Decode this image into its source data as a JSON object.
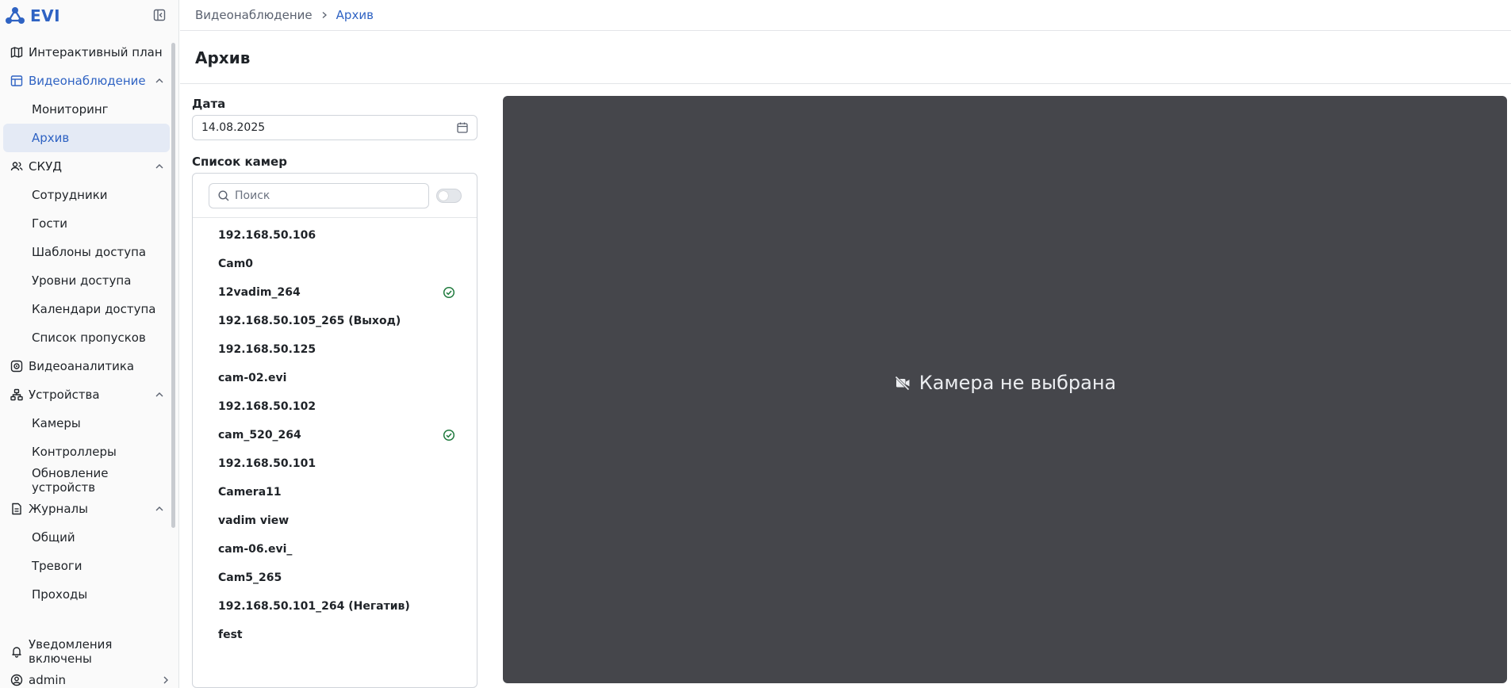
{
  "app": {
    "name": "EVI",
    "brand_color": "#2f63c3"
  },
  "breadcrumb": {
    "parent": "Видеонаблюдение",
    "current": "Архив"
  },
  "page": {
    "title": "Архив"
  },
  "sidebar": {
    "items": [
      {
        "label": "Интерактивный план",
        "icon": "map-icon"
      },
      {
        "label": "Видеонаблюдение",
        "icon": "video-grid-icon",
        "expanded": true,
        "children": [
          "Мониторинг",
          "Архив"
        ]
      },
      {
        "label": "СКУД",
        "icon": "users-icon",
        "expanded": true,
        "children": [
          "Сотрудники",
          "Гости",
          "Шаблоны доступа",
          "Уровни доступа",
          "Календари доступа",
          "Список пропусков"
        ]
      },
      {
        "label": "Видеоаналитика",
        "icon": "analytics-icon"
      },
      {
        "label": "Устройства",
        "icon": "devices-icon",
        "expanded": true,
        "children": [
          "Камеры",
          "Контроллеры",
          "Обновление устройств"
        ]
      },
      {
        "label": "Журналы",
        "icon": "journal-icon",
        "expanded": true,
        "children": [
          "Общий",
          "Тревоги",
          "Проходы"
        ]
      }
    ],
    "selected": "Архив",
    "notifications_label": "Уведомления включены",
    "user_label": "admin"
  },
  "filters": {
    "date_label": "Дата",
    "date_value": "14.08.2025",
    "camera_list_label": "Список камер",
    "search_placeholder": "Поиск"
  },
  "cameras": [
    {
      "name": "192.168.50.106",
      "ok": false
    },
    {
      "name": "Cam0",
      "ok": false
    },
    {
      "name": "12vadim_264",
      "ok": true
    },
    {
      "name": "192.168.50.105_265 (Выход)",
      "ok": false
    },
    {
      "name": "192.168.50.125",
      "ok": false
    },
    {
      "name": "cam-02.evi",
      "ok": false
    },
    {
      "name": "192.168.50.102",
      "ok": false
    },
    {
      "name": "cam_520_264",
      "ok": true
    },
    {
      "name": "192.168.50.101",
      "ok": false
    },
    {
      "name": "Camera11",
      "ok": false
    },
    {
      "name": "vadim view",
      "ok": false
    },
    {
      "name": "cam-06.evi_",
      "ok": false
    },
    {
      "name": "Cam5_265",
      "ok": false
    },
    {
      "name": "192.168.50.101_264 (Негатив)",
      "ok": false
    },
    {
      "name": "fest",
      "ok": false
    }
  ],
  "video": {
    "empty_message": "Камера не выбрана",
    "background": "#45464b"
  }
}
